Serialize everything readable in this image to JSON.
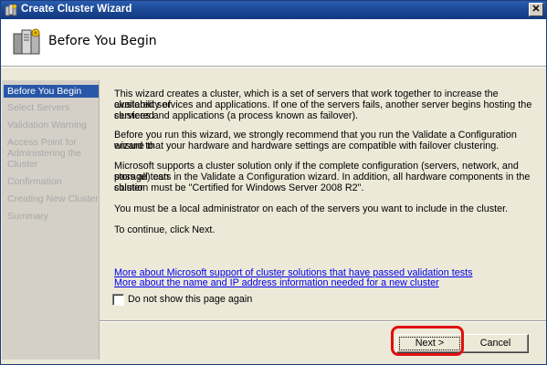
{
  "window": {
    "title": "Create Cluster Wizard",
    "close_label": "✕"
  },
  "header": {
    "title": "Before You Begin",
    "icon": "cluster-servers-icon"
  },
  "steps": [
    {
      "label": "Before You Begin",
      "active": true
    },
    {
      "label": "Select Servers"
    },
    {
      "label": "Validation Warning"
    },
    {
      "label": "Access Point for"
    },
    {
      "label": "Administering the"
    },
    {
      "label": "Cluster"
    },
    {
      "label": "Confirmation"
    },
    {
      "label": "Creating New Cluster"
    },
    {
      "label": "Summary"
    }
  ],
  "content": {
    "p1_l1": "This wizard creates a cluster, which is a set of servers that work together to increase the availability of",
    "p1_l2": "clustered services and applications. If one of the servers fails, another server begins hosting the clustered",
    "p1_l3": "services and applications (a process known as failover).",
    "p2_l1": "Before you run this wizard, we strongly recommend that you run the Validate a Configuration wizard to",
    "p2_l2": "ensure that your hardware and hardware settings are compatible with failover clustering.",
    "p3_l1": "Microsoft supports a cluster solution only if the complete configuration (servers, network, and storage) can",
    "p3_l2": "pass all tests in the Validate a Configuration wizard.  In addition, all hardware components in the cluster",
    "p3_l3": "solution must be \"Certified for Windows Server 2008 R2\".",
    "p4": "You must be a local administrator on each of the servers you want to include in the cluster.",
    "p5": "To continue, click Next."
  },
  "links": {
    "support": "More about Microsoft support of cluster solutions that have passed validation tests",
    "name_ip": "More about the name and IP address information needed for a new cluster"
  },
  "checkbox": {
    "label": "Do not show this page again",
    "checked": false
  },
  "buttons": {
    "next": "Next >",
    "cancel": "Cancel"
  },
  "colors": {
    "title_bar": "#1b4793",
    "active_step": "#2857a8",
    "link": "#0000ee",
    "highlight": "#e01010"
  }
}
